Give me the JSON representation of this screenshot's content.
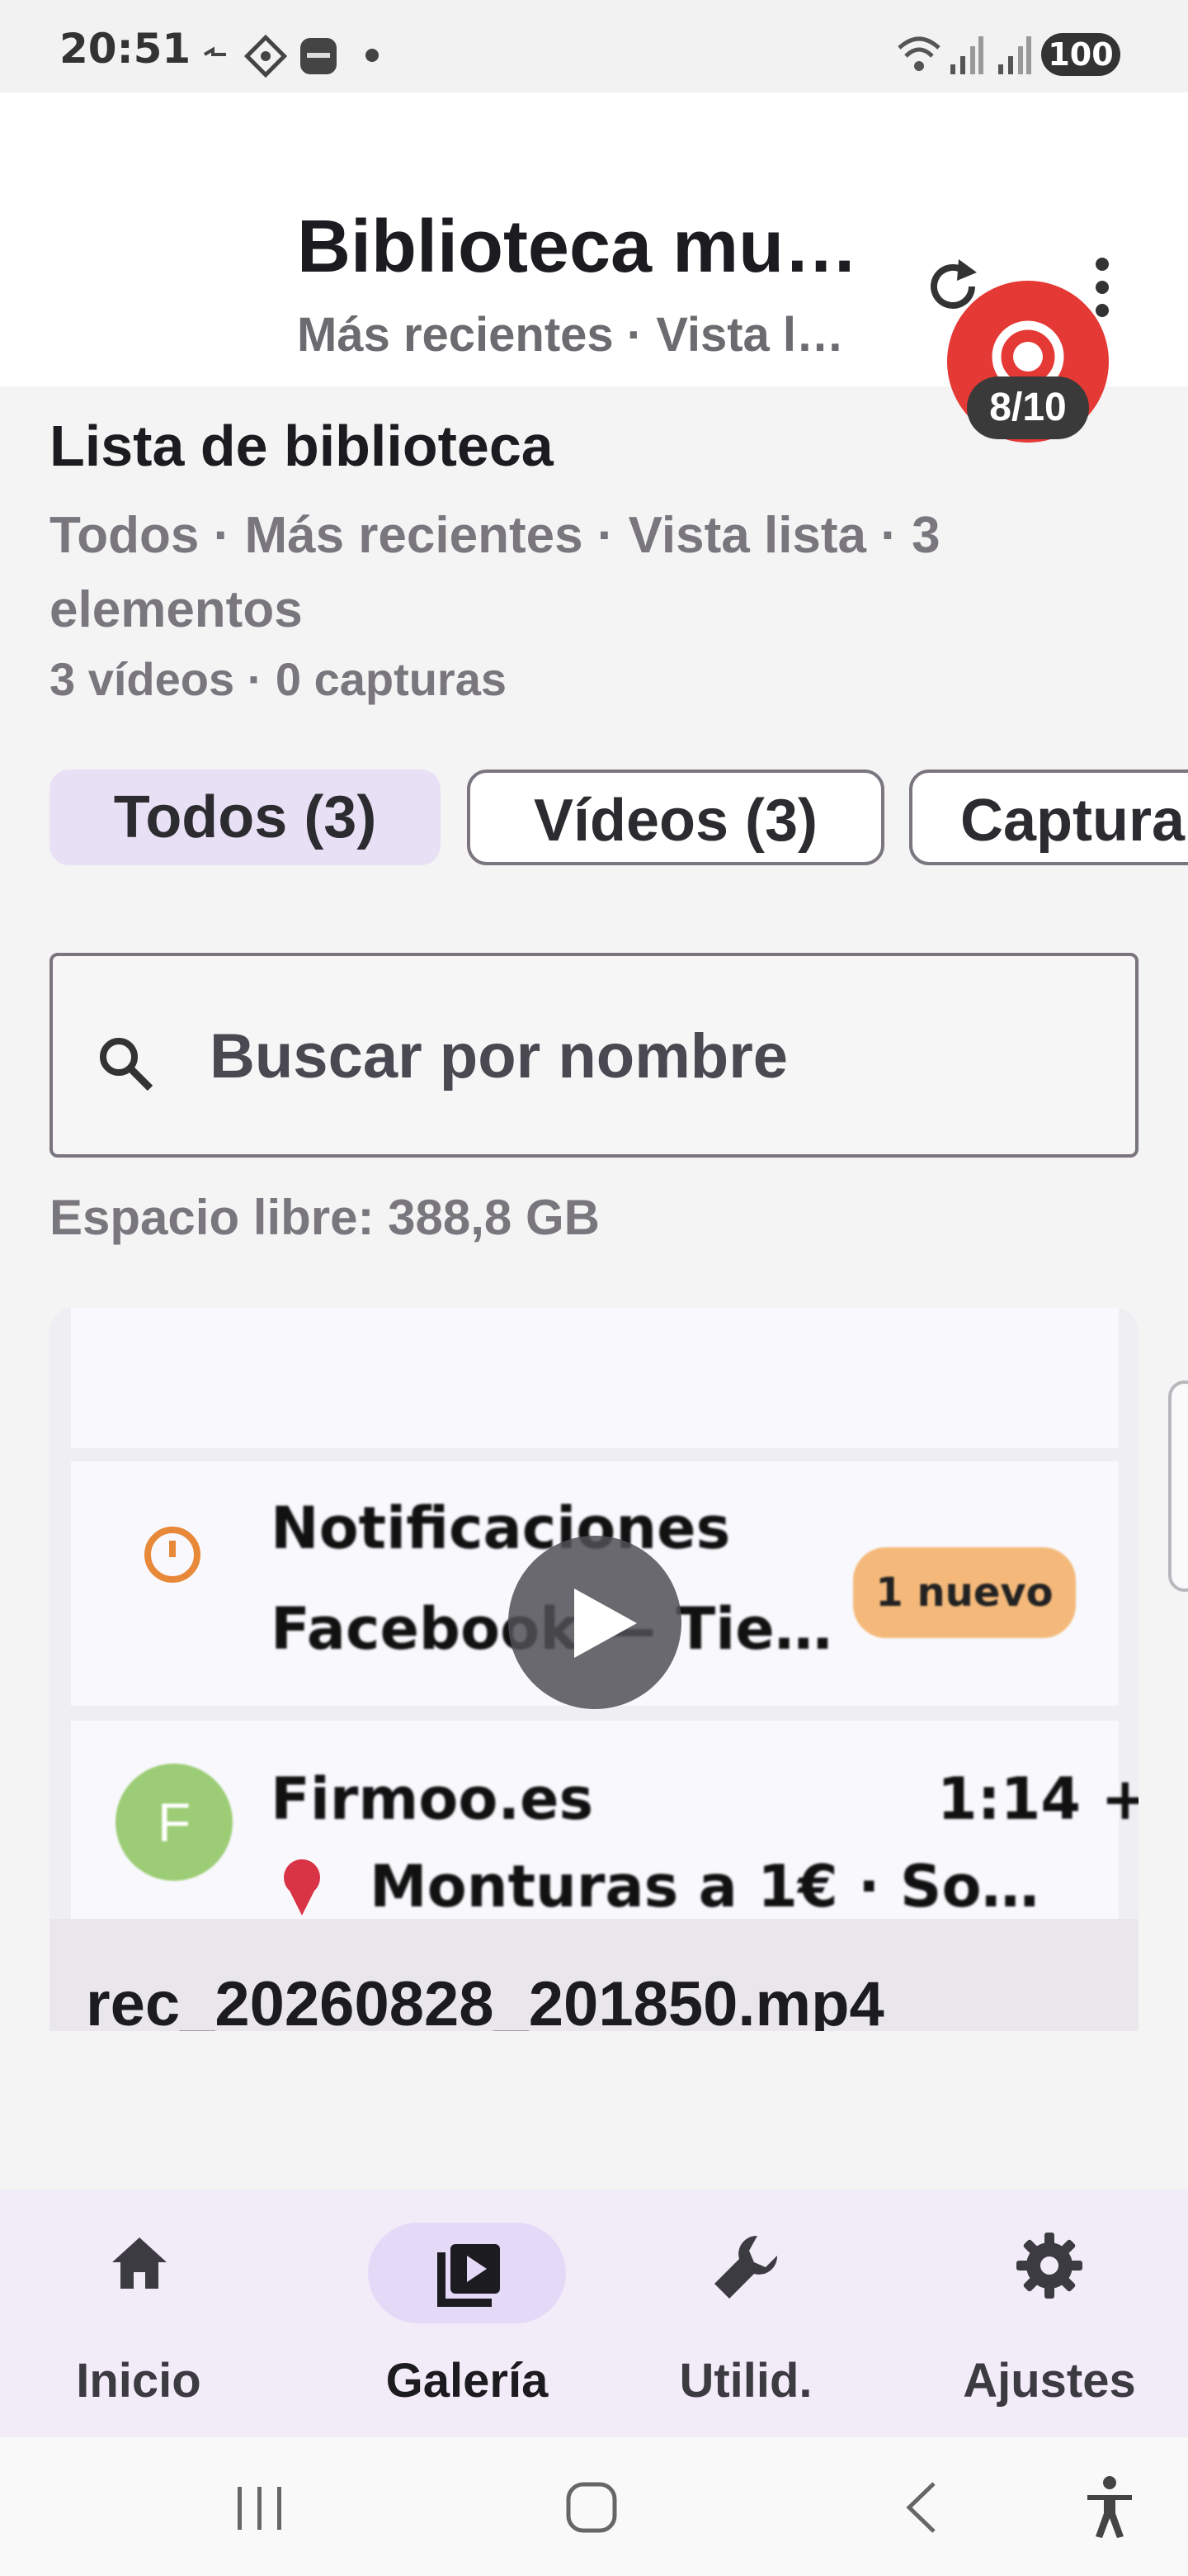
{
  "status_bar": {
    "time": "20:51",
    "battery": "100"
  },
  "header": {
    "title": "Biblioteca mu…",
    "subtitle": "Más recientes · Vista l…",
    "recording_count": "8/10"
  },
  "library": {
    "title": "Lista de biblioteca",
    "summary": "Todos · Más recientes · Vista lista · 3 elementos",
    "counts": "3 vídeos · 0 capturas"
  },
  "filters": [
    {
      "label": "Todos (3)",
      "selected": true
    },
    {
      "label": "Vídeos (3)",
      "selected": false
    },
    {
      "label": "Captura",
      "selected": false
    }
  ],
  "search": {
    "placeholder": "Buscar por nombre"
  },
  "storage": {
    "free_space": "Espacio libre: 388,8 GB"
  },
  "media_items": [
    {
      "file_name": "rec_20260828_201850.mp4",
      "thumbnail": {
        "row1_title": "Notificaciones",
        "row1_subtitle": "Facebook — Tie…",
        "row1_badge": "1 nuevo",
        "row2_avatar": "F",
        "row2_title": "Firmoo.es",
        "row2_time": "1:14 +",
        "row2_subtitle": "Monturas a 1€ · So…"
      }
    }
  ],
  "bottom_nav": [
    {
      "label": "Inicio",
      "icon": "home-icon",
      "selected": false
    },
    {
      "label": "Galería",
      "icon": "video-library-icon",
      "selected": true
    },
    {
      "label": "Utilid.",
      "icon": "wrench-icon",
      "selected": false
    },
    {
      "label": "Ajustes",
      "icon": "gear-icon",
      "selected": false
    }
  ],
  "colors": {
    "accent_container": "#e8e1f5",
    "record_red": "#e53935",
    "nav_background": "#f2ecf8"
  }
}
